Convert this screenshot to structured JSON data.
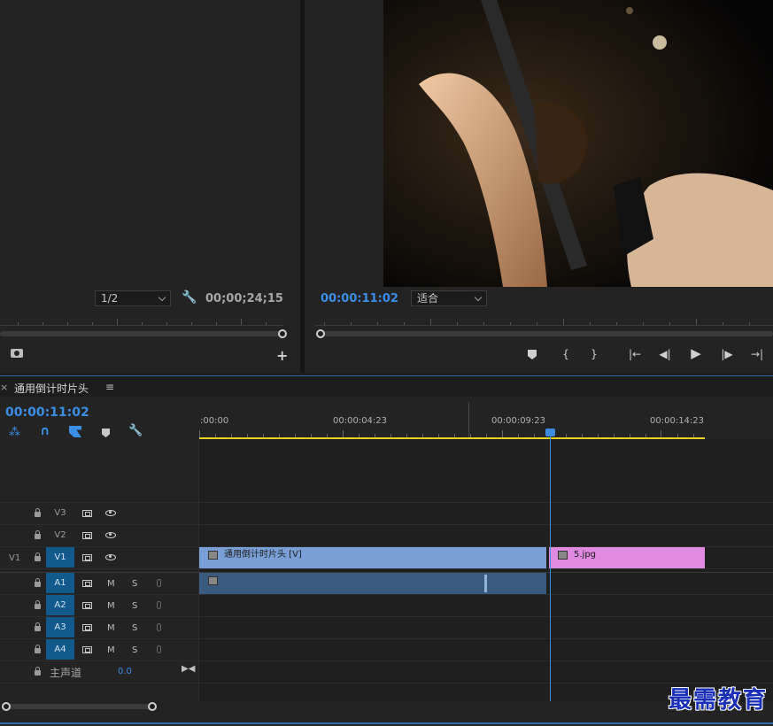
{
  "source_monitor": {
    "resolution": "1/2",
    "timecode": "00;00;24;15"
  },
  "program_monitor": {
    "timecode": "00:00:11:02",
    "fit": "适合",
    "controls": {
      "marker": "marker-icon",
      "in": "{",
      "out": "}",
      "go_in": "|←",
      "step_back": "◀|",
      "play": "▶",
      "step_fwd": "|▶",
      "go_out": "→|"
    }
  },
  "timeline": {
    "close": "×",
    "sequence_name": "通用倒计时片头",
    "menu": "≡",
    "timecode": "00:00:11:02",
    "ruler_labels": [
      ":00:00",
      "00:00:04:23",
      "00:00:09:23",
      "00:00:14:23"
    ],
    "video_tracks": [
      {
        "label": "V3",
        "source": ""
      },
      {
        "label": "V2",
        "source": ""
      },
      {
        "label": "V1",
        "source": "V1"
      }
    ],
    "audio_tracks": [
      {
        "label": "A1",
        "m": "M",
        "s": "S"
      },
      {
        "label": "A2",
        "m": "M",
        "s": "S"
      },
      {
        "label": "A3",
        "m": "M",
        "s": "S"
      },
      {
        "label": "A4",
        "m": "M",
        "s": "S"
      }
    ],
    "master": {
      "label": "主声道",
      "value": "0.0"
    },
    "clips": {
      "video_clip_1": "通用倒计时片头 [V]",
      "video_clip_2": "5.jpg"
    },
    "colors": {
      "accent": "#3a8ee6",
      "video_clip": "#7a9fd6",
      "image_clip": "#e08ae0",
      "audio_clip": "#3a5a80",
      "work_area": "#e6d21f"
    }
  },
  "watermark": "最需教育"
}
